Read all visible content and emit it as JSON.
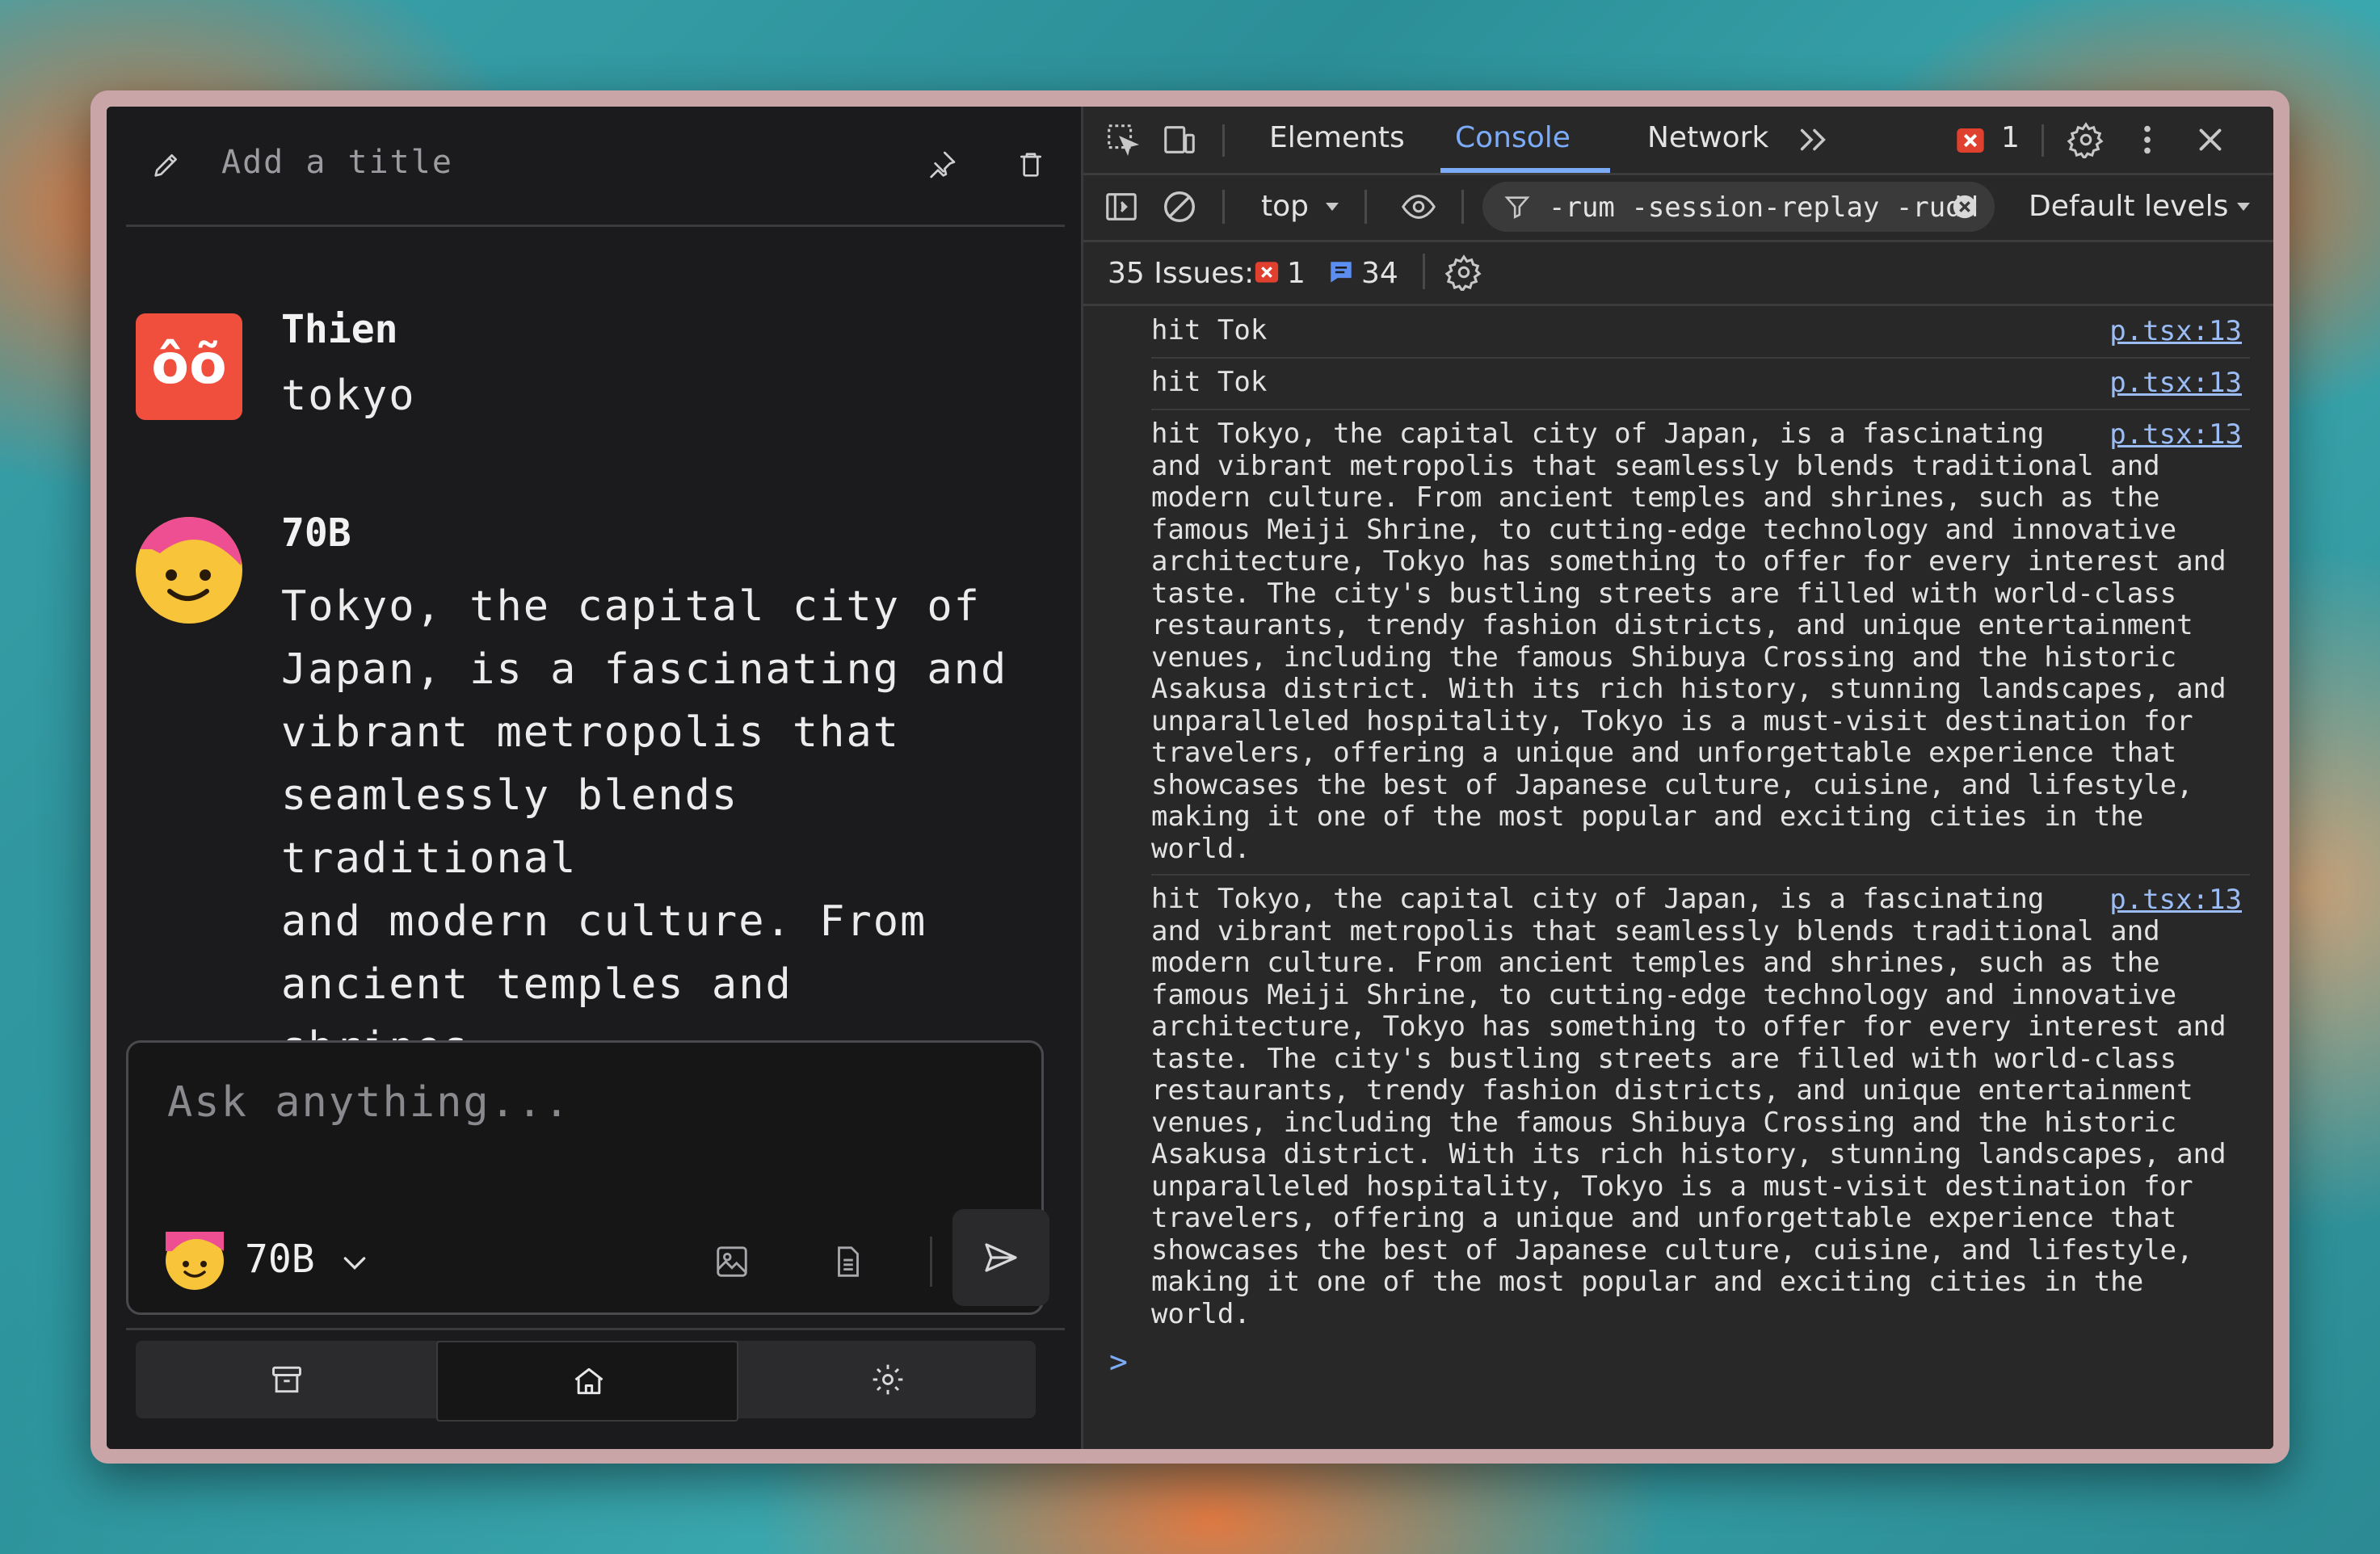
{
  "chat": {
    "title_placeholder": "Add a title",
    "user": {
      "name": "Thien",
      "avatar_text": "ôõ",
      "message": "tokyo"
    },
    "bot": {
      "name": "70B",
      "message": "Tokyo, the capital city of\nJapan, is a fascinating and\nvibrant metropolis that\nseamlessly blends traditional\nand modern culture. From\nancient temples and shrines,\nsuch as the famous Meiji\nShrine, to cutting-edge"
    },
    "composer": {
      "placeholder": "Ask anything...",
      "model": "70B"
    }
  },
  "devtools": {
    "tabs": [
      "Elements",
      "Console",
      "Network"
    ],
    "active_tab": "Console",
    "error_count": "1",
    "context": "top",
    "filter": "-rum -session-replay -rudd",
    "levels": "Default levels",
    "issues_label": "35 Issues:",
    "issues_errors": "1",
    "issues_info": "34",
    "logs": [
      {
        "text": "hit Tok",
        "source": "p.tsx:13"
      },
      {
        "text": "hit Tok",
        "source": "p.tsx:13"
      },
      {
        "text": "hit Tokyo, the capital city of Japan, is a fascinating\nand vibrant metropolis that seamlessly blends traditional and\nmodern culture. From ancient temples and shrines, such as the\nfamous Meiji Shrine, to cutting-edge technology and innovative\narchitecture, Tokyo has something to offer for every interest and\ntaste. The city's bustling streets are filled with world-class\nrestaurants, trendy fashion districts, and unique entertainment\nvenues, including the famous Shibuya Crossing and the historic\nAsakusa district. With its rich history, stunning landscapes, and\nunparalleled hospitality, Tokyo is a must-visit destination for\ntravelers, offering a unique and unforgettable experience that\nshowcases the best of Japanese culture, cuisine, and lifestyle,\nmaking it one of the most popular and exciting cities in the\nworld.",
        "source": "p.tsx:13"
      },
      {
        "text": "hit Tokyo, the capital city of Japan, is a fascinating\nand vibrant metropolis that seamlessly blends traditional and\nmodern culture. From ancient temples and shrines, such as the\nfamous Meiji Shrine, to cutting-edge technology and innovative\narchitecture, Tokyo has something to offer for every interest and\ntaste. The city's bustling streets are filled with world-class\nrestaurants, trendy fashion districts, and unique entertainment\nvenues, including the famous Shibuya Crossing and the historic\nAsakusa district. With its rich history, stunning landscapes, and\nunparalleled hospitality, Tokyo is a must-visit destination for\ntravelers, offering a unique and unforgettable experience that\nshowcases the best of Japanese culture, cuisine, and lifestyle,\nmaking it one of the most popular and exciting cities in the\nworld.",
        "source": "p.tsx:13"
      }
    ],
    "prompt": ">"
  },
  "colors": {
    "accent": "#7cacf8",
    "user_avatar": "#ef4f3c",
    "bot_avatar": "#f7c43a",
    "error": "#e0412f"
  }
}
